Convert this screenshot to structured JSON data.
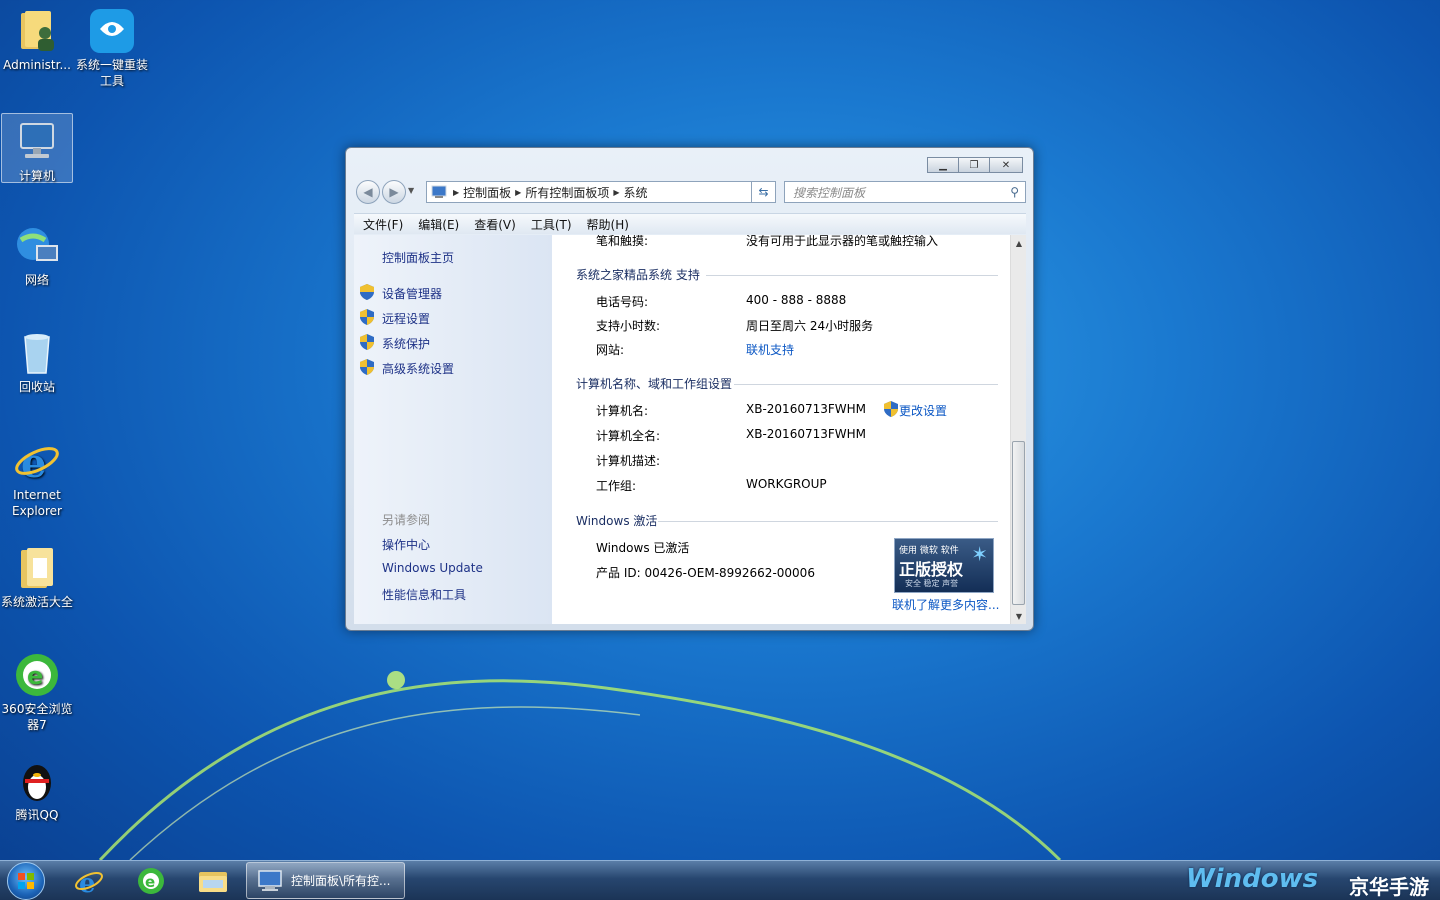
{
  "desktop": {
    "icons": [
      {
        "label": "Administr..."
      },
      {
        "label": "系统一键重装工具"
      },
      {
        "label": "计算机"
      },
      {
        "label": "网络"
      },
      {
        "label": "回收站"
      },
      {
        "label": "Internet Explorer"
      },
      {
        "label": "系统激活大全"
      },
      {
        "label": "360安全浏览器7"
      },
      {
        "label": "腾讯QQ"
      }
    ]
  },
  "window": {
    "address": {
      "crumb1": "控制面板",
      "crumb2": "所有控制面板项",
      "crumb3": "系统"
    },
    "search_placeholder": "搜索控制面板",
    "menu": [
      "文件(F)",
      "编辑(E)",
      "查看(V)",
      "工具(T)",
      "帮助(H)"
    ],
    "left_pane": {
      "home": "控制面板主页",
      "links": [
        "设备管理器",
        "远程设置",
        "系统保护",
        "高级系统设置"
      ],
      "see_also_title": "另请参阅",
      "see_also": [
        "操作中心",
        "Windows Update",
        "性能信息和工具"
      ]
    },
    "pen_touch": {
      "label": "笔和触摸:",
      "value": "没有可用于此显示器的笔或触控输入"
    },
    "support": {
      "title": "系统之家精品系统 支持",
      "phone_label": "电话号码:",
      "phone": "400 - 888 - 8888",
      "hours_label": "支持小时数:",
      "hours": "周日至周六  24小时服务",
      "website_label": "网站:",
      "website": "联机支持"
    },
    "computer": {
      "title": "计算机名称、域和工作组设置",
      "name_label": "计算机名:",
      "name": "XB-20160713FWHM",
      "change": "更改设置",
      "fullname_label": "计算机全名:",
      "fullname": "XB-20160713FWHM",
      "desc_label": "计算机描述:",
      "workgroup_label": "工作组:",
      "workgroup": "WORKGROUP"
    },
    "activation": {
      "title": "Windows 激活",
      "status": "Windows 已激活",
      "product_id": "产品 ID: 00426-OEM-8992662-00006",
      "badge_top": "使用 微软 软件",
      "badge_main": "正版授权",
      "badge_bottom": "安全 稳定 声誉",
      "learn_more": "联机了解更多内容..."
    }
  },
  "taskbar": {
    "task_label": "控制面板\\所有控...",
    "watermark": "Windows",
    "watermark_cn": "京华手游"
  },
  "colors": {
    "link": "#1e3287",
    "accent": "#0b57c4"
  }
}
